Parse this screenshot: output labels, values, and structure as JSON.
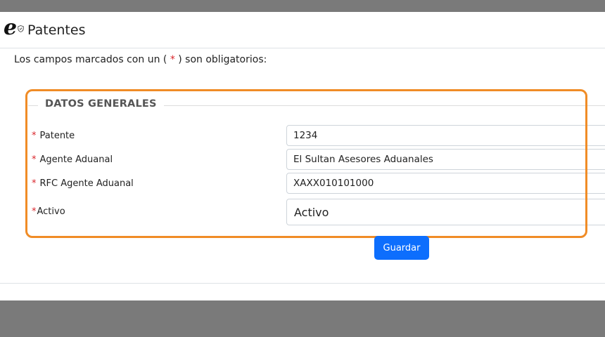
{
  "header": {
    "title": "Patentes",
    "logo_icon": "e-logo-icon"
  },
  "required_note": {
    "prefix": "Los campos marcados con un ( ",
    "star": "*",
    "suffix": " ) son obligatorios:"
  },
  "section": {
    "legend": "DATOS GENERALES",
    "fields": [
      {
        "star": "*",
        "label": "Patente",
        "value": "1234"
      },
      {
        "star": "*",
        "label": "Agente Aduanal",
        "value": "El Sultan Asesores Aduanales"
      },
      {
        "star": "*",
        "label": "RFC Agente Aduanal",
        "value": "XAXX010101000"
      },
      {
        "star": "*",
        "label": "Activo",
        "value": "Activo"
      }
    ]
  },
  "actions": {
    "save_label": "Guardar"
  },
  "colors": {
    "accent": "#0d6efd",
    "required": "#d9252b",
    "highlight": "#f08c26",
    "overlay": "#7a7a7a"
  }
}
